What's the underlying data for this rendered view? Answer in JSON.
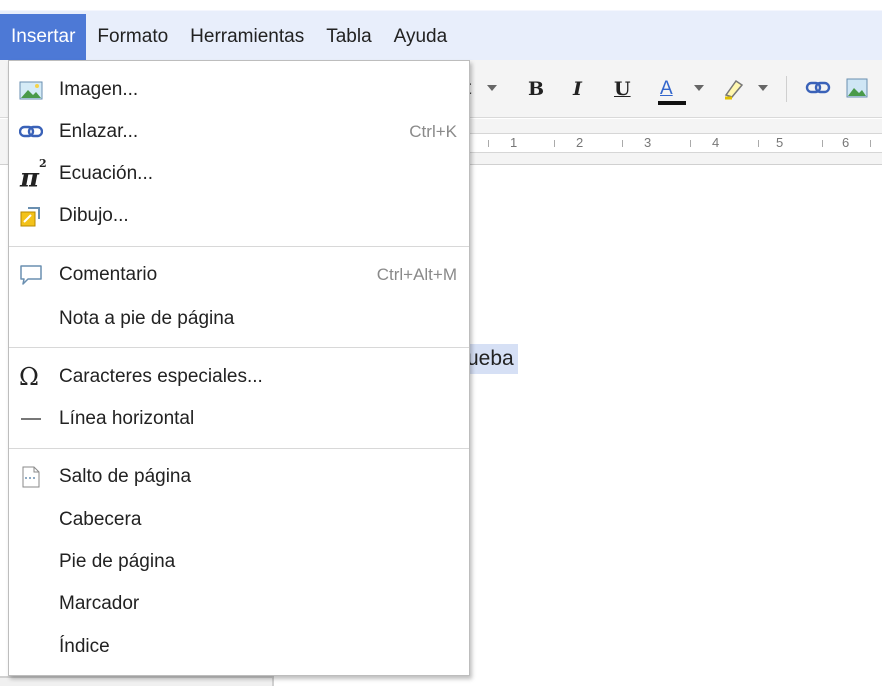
{
  "menubar": {
    "items": [
      {
        "label": "Insertar",
        "active": true
      },
      {
        "label": "Formato"
      },
      {
        "label": "Herramientas"
      },
      {
        "label": "Tabla"
      },
      {
        "label": "Ayuda"
      }
    ]
  },
  "toolbar": {
    "font_size_fragment": "t",
    "bold": "B",
    "italic": "I",
    "underline": "U",
    "text_color": "A"
  },
  "ruler": {
    "numbers": [
      "1",
      "2",
      "3",
      "4",
      "5",
      "6"
    ]
  },
  "document": {
    "visible_text": "ueba"
  },
  "insert_menu": {
    "items": [
      {
        "label": "Imagen...",
        "icon": "image-icon"
      },
      {
        "label": "Enlazar...",
        "shortcut": "Ctrl+K",
        "icon": "link-icon"
      },
      {
        "label": "Ecuación...",
        "icon": "equation-icon"
      },
      {
        "label": "Dibujo...",
        "icon": "drawing-icon"
      },
      {
        "label": "Comentario",
        "shortcut": "Ctrl+Alt+M",
        "icon": "comment-icon"
      },
      {
        "label": "Nota a pie de página"
      },
      {
        "label": "Caracteres especiales...",
        "icon": "omega-icon"
      },
      {
        "label": "Línea horizontal",
        "icon": "horizontal-line-icon"
      },
      {
        "label": "Salto de página",
        "icon": "page-break-icon"
      },
      {
        "label": "Cabecera"
      },
      {
        "label": "Pie de página"
      },
      {
        "label": "Marcador"
      },
      {
        "label": "Índice"
      }
    ]
  },
  "colors": {
    "menubar_bg": "#e8eefb",
    "active_menu": "#4d79d6",
    "selection": "#d6e0f5",
    "shortcut_text": "#8a8a8a"
  }
}
